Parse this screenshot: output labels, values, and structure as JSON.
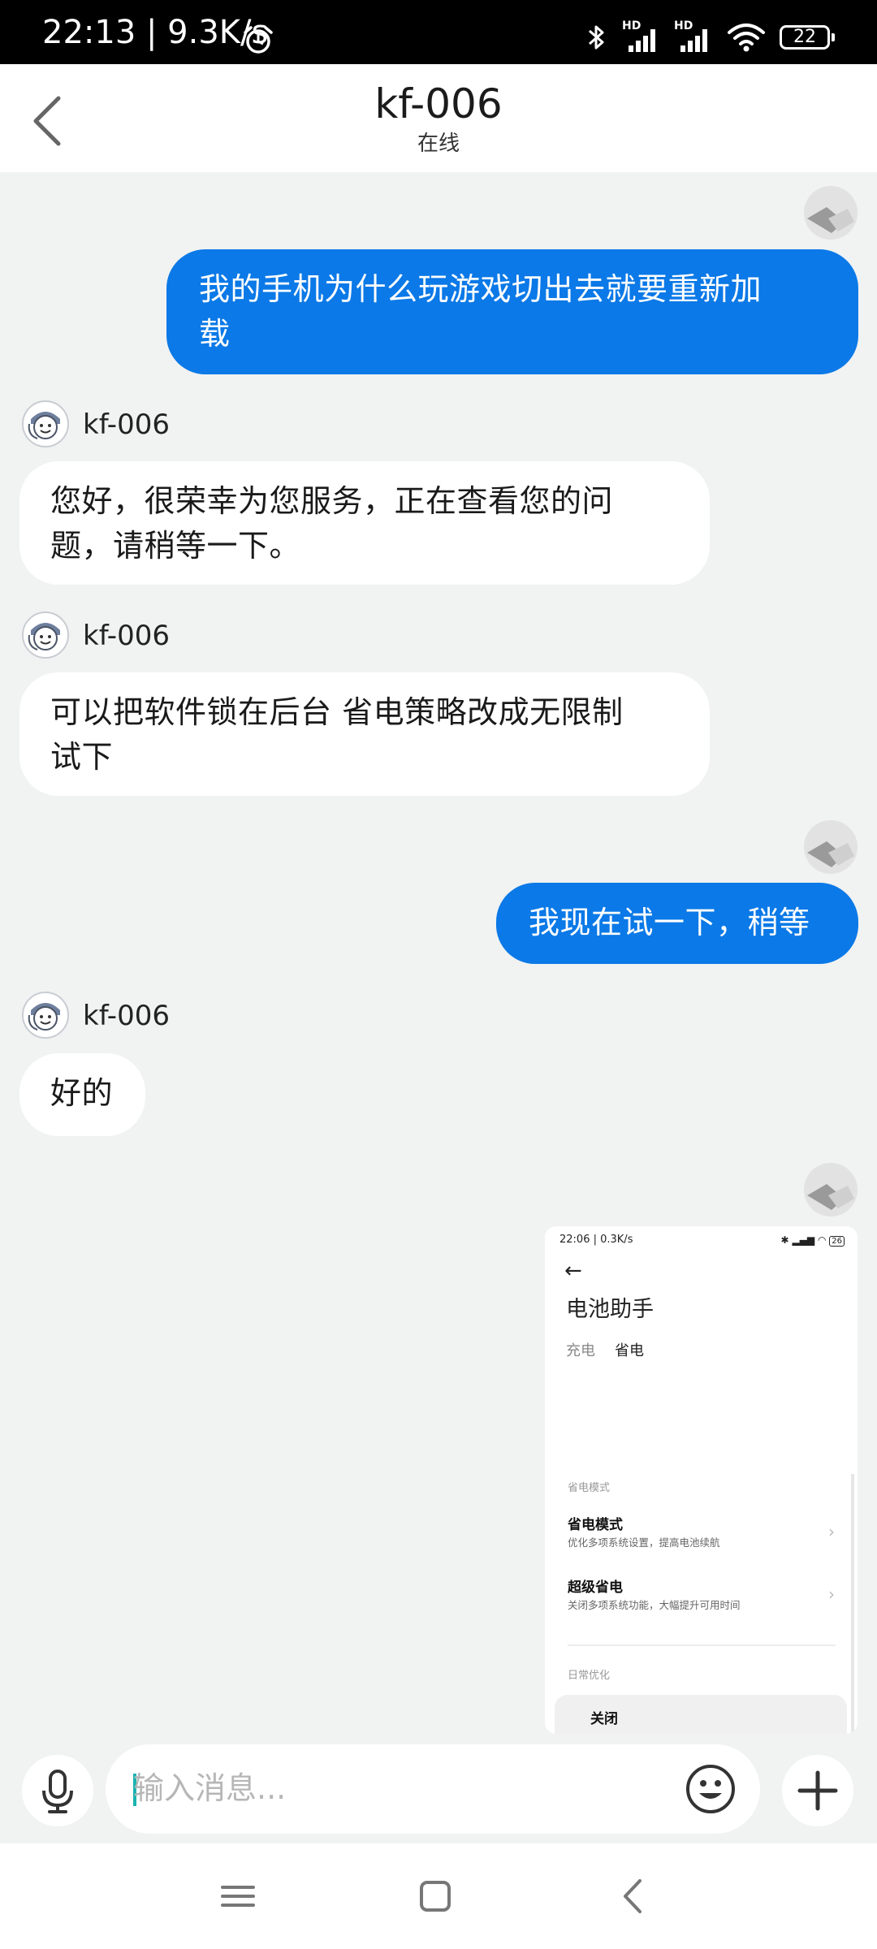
{
  "status_bar": {
    "time_speed": "22:13 | 9.3K/s",
    "network_labels": [
      "HD",
      "HD"
    ],
    "battery": "22"
  },
  "header": {
    "title": "kf-006",
    "subtitle": "在线"
  },
  "messages": [
    {
      "from": "user",
      "lines": [
        "我的手机为什么玩游戏切出去就要重新加",
        "载"
      ]
    },
    {
      "from": "agent",
      "name": "kf-006",
      "lines": [
        "您好，很荣幸为您服务，正在查看您的问",
        "题，请稍等一下。"
      ]
    },
    {
      "from": "agent",
      "name": "kf-006",
      "lines": [
        "可以把软件锁在后台 省电策略改成无限制",
        "试下"
      ]
    },
    {
      "from": "user",
      "lines": [
        "我现在试一下，稍等"
      ]
    },
    {
      "from": "agent",
      "name": "kf-006",
      "lines": [
        "好的"
      ]
    }
  ],
  "shared_screenshot": {
    "status_time": "22:06 | 0.3K/s",
    "status_battery": "26",
    "title": "电池助手",
    "tabs": [
      "充电",
      "省电"
    ],
    "sections": [
      "省电模式",
      "日常优化"
    ],
    "items": [
      {
        "title": "省电模式",
        "desc": "优化多项系统设置，提高电池续航"
      },
      {
        "title": "超级省电",
        "desc": "关闭多项系统功能，大幅提升可用时间"
      }
    ],
    "card_title": "关闭"
  },
  "composer": {
    "placeholder": "输入消息..."
  },
  "colors": {
    "outgoing_bubble": "#0b79e7",
    "incoming_bubble": "#ffffff",
    "chat_background": "#f1f2f2"
  },
  "icons": [
    "back-icon",
    "alarm-icon",
    "bluetooth-icon",
    "signal-icon",
    "wifi-icon",
    "battery-icon",
    "mic-icon",
    "emoji-icon",
    "plus-icon",
    "menu-icon",
    "home-icon",
    "nav-back-icon"
  ]
}
